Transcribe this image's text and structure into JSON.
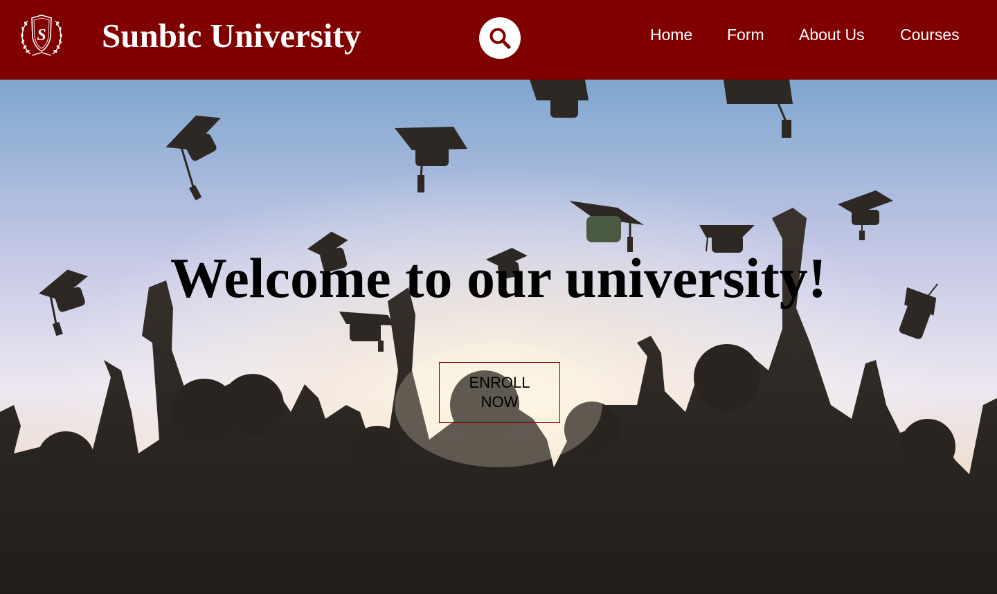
{
  "header": {
    "brand": "Sunbic University",
    "logo_letter": "S",
    "nav": [
      {
        "label": "Home"
      },
      {
        "label": "Form"
      },
      {
        "label": "About Us"
      },
      {
        "label": "Courses"
      }
    ]
  },
  "hero": {
    "title": "Welcome to our university!",
    "cta_label": "ENROLL NOW"
  },
  "colors": {
    "header_bg": "#800000",
    "text_on_header": "#ffffff",
    "button_border": "#800000"
  },
  "icons": {
    "logo": "laurel-shield-crest-icon",
    "search": "search-icon"
  }
}
